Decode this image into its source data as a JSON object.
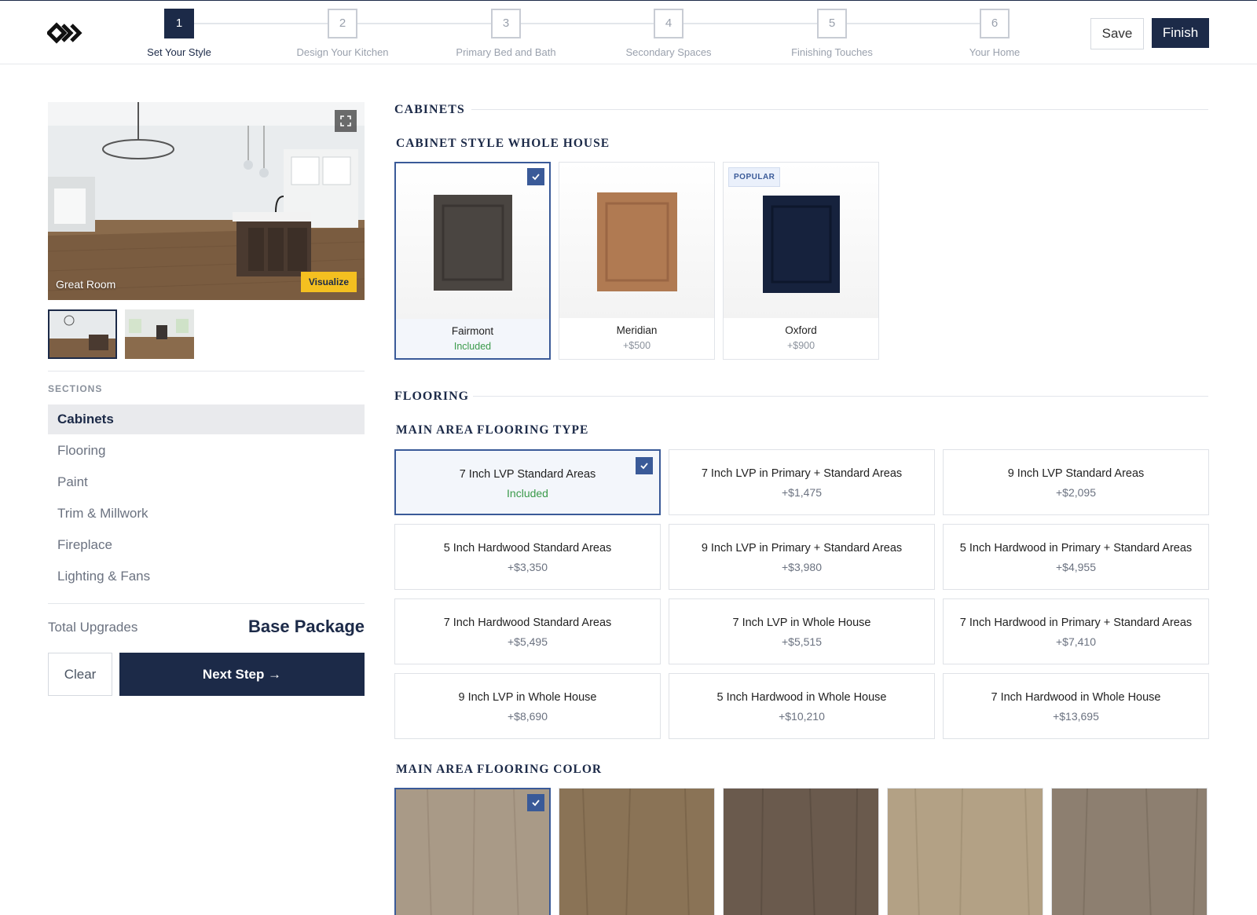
{
  "header": {
    "steps": [
      {
        "num": "1",
        "label": "Set Your Style"
      },
      {
        "num": "2",
        "label": "Design Your Kitchen"
      },
      {
        "num": "3",
        "label": "Primary Bed and Bath"
      },
      {
        "num": "4",
        "label": "Secondary Spaces"
      },
      {
        "num": "5",
        "label": "Finishing Touches"
      },
      {
        "num": "6",
        "label": "Your Home"
      }
    ],
    "active_step": 1,
    "save_label": "Save",
    "finish_label": "Finish"
  },
  "preview": {
    "caption": "Great Room",
    "visualize_label": "Visualize",
    "thumbnails_count": 2
  },
  "sidebar": {
    "sections_title": "SECTIONS",
    "items": [
      {
        "label": "Cabinets",
        "active": true
      },
      {
        "label": "Flooring",
        "active": false
      },
      {
        "label": "Paint",
        "active": false
      },
      {
        "label": "Trim & Millwork",
        "active": false
      },
      {
        "label": "Fireplace",
        "active": false
      },
      {
        "label": "Lighting & Fans",
        "active": false
      }
    ],
    "total_label": "Total Upgrades",
    "total_value": "Base Package",
    "clear_label": "Clear",
    "next_label": "Next Step →"
  },
  "cabinets": {
    "group_title": "CABINETS",
    "subsection_title": "CABINET STYLE WHOLE HOUSE",
    "options": [
      {
        "name": "Fairmont",
        "price": "Included",
        "selected": true,
        "color": "#4a4541"
      },
      {
        "name": "Meridian",
        "price": "+$500",
        "selected": false,
        "color": "#b07a52"
      },
      {
        "name": "Oxford",
        "price": "+$900",
        "selected": false,
        "color": "#16223d",
        "badge": "POPULAR"
      }
    ]
  },
  "flooring": {
    "group_title": "FLOORING",
    "type_title": "MAIN AREA FLOORING TYPE",
    "options": [
      {
        "name": "7 Inch LVP Standard Areas",
        "price": "Included",
        "selected": true
      },
      {
        "name": "7 Inch LVP in Primary + Standard Areas",
        "price": "+$1,475"
      },
      {
        "name": "9 Inch LVP Standard Areas",
        "price": "+$2,095"
      },
      {
        "name": "5 Inch Hardwood Standard Areas",
        "price": "+$3,350"
      },
      {
        "name": "9 Inch LVP in Primary + Standard Areas",
        "price": "+$3,980"
      },
      {
        "name": "5 Inch Hardwood in Primary + Standard Areas",
        "price": "+$4,955"
      },
      {
        "name": "7 Inch Hardwood Standard Areas",
        "price": "+$5,495"
      },
      {
        "name": "7 Inch LVP in Whole House",
        "price": "+$5,515"
      },
      {
        "name": "7 Inch Hardwood in Primary + Standard Areas",
        "price": "+$7,410"
      },
      {
        "name": "9 Inch LVP in Whole House",
        "price": "+$8,690"
      },
      {
        "name": "5 Inch Hardwood in Whole House",
        "price": "+$10,210"
      },
      {
        "name": "7 Inch Hardwood in Whole House",
        "price": "+$13,695"
      }
    ],
    "color_title": "MAIN AREA FLOORING COLOR",
    "colors": [
      {
        "tone": "#a99a87",
        "selected": true
      },
      {
        "tone": "#8a7356"
      },
      {
        "tone": "#6a5a4d"
      },
      {
        "tone": "#b3a185"
      },
      {
        "tone": "#8d7f70"
      }
    ]
  },
  "colors": {
    "brand_navy": "#1c2a48",
    "accent_blue": "#3a5a98",
    "included_green": "#3a9a4a",
    "visualize_yellow": "#f4c020"
  }
}
